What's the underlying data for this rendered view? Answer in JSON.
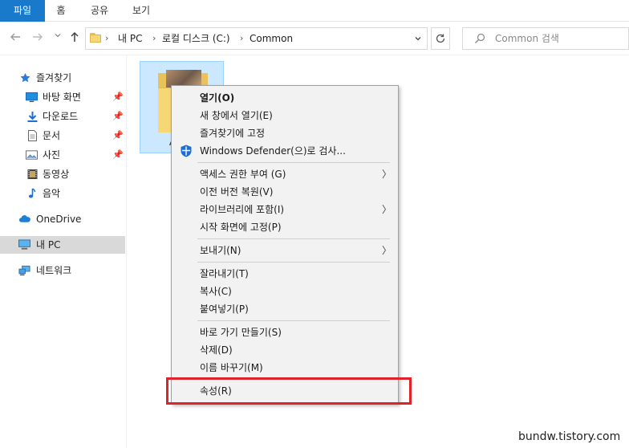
{
  "ribbon": {
    "tabs": [
      "파일",
      "홈",
      "공유",
      "보기"
    ]
  },
  "navigation": {
    "back_icon": "arrow-left-icon",
    "forward_icon": "arrow-right-icon",
    "recent_icon": "chevron-down-icon",
    "up_icon": "arrow-up-icon"
  },
  "address": {
    "crumbs": [
      "내 PC",
      "로컬 디스크 (C:)",
      "Common"
    ]
  },
  "search": {
    "placeholder": "Common 검색"
  },
  "sidebar": {
    "items": [
      {
        "label": "즐겨찾기",
        "icon": "star-icon",
        "pinned": false
      },
      {
        "label": "바탕 화면",
        "icon": "desktop-icon",
        "pinned": true
      },
      {
        "label": "다운로드",
        "icon": "download-icon",
        "pinned": true
      },
      {
        "label": "문서",
        "icon": "document-icon",
        "pinned": true
      },
      {
        "label": "사진",
        "icon": "picture-icon",
        "pinned": true
      },
      {
        "label": "동영상",
        "icon": "video-icon",
        "pinned": false
      },
      {
        "label": "음악",
        "icon": "music-icon",
        "pinned": false
      },
      {
        "label": "OneDrive",
        "icon": "cloud-icon",
        "pinned": false
      },
      {
        "label": "내 PC",
        "icon": "computer-icon",
        "pinned": false,
        "selected": true
      },
      {
        "label": "네트워크",
        "icon": "network-icon",
        "pinned": false
      }
    ]
  },
  "content": {
    "folder_name": "A"
  },
  "context_menu": {
    "items": [
      {
        "label": "열기(O)",
        "bold": true
      },
      {
        "label": "새 창에서 열기(E)"
      },
      {
        "label": "즐겨찾기에 고정"
      },
      {
        "label": "Windows Defender(으)로 검사...",
        "icon": "windows-defender-icon"
      },
      {
        "label": "액세스 권한 부여 (G)",
        "submenu": true
      },
      {
        "label": "이전 버전 복원(V)"
      },
      {
        "label": "라이브러리에 포함(I)",
        "submenu": true
      },
      {
        "label": "시작 화면에 고정(P)"
      },
      {
        "label": "보내기(N)",
        "submenu": true
      },
      {
        "label": "잘라내기(T)"
      },
      {
        "label": "복사(C)"
      },
      {
        "label": "붙여넣기(P)"
      },
      {
        "label": "바로 가기 만들기(S)"
      },
      {
        "label": "삭제(D)"
      },
      {
        "label": "이름 바꾸기(M)"
      },
      {
        "label": "속성(R)",
        "highlighted": true
      }
    ]
  },
  "annotation": {
    "highlight_color": "#e0232a"
  },
  "watermark": "bundw.tistory.com",
  "colors": {
    "file_tab": "#1979ca",
    "selection": "#cce8ff"
  }
}
